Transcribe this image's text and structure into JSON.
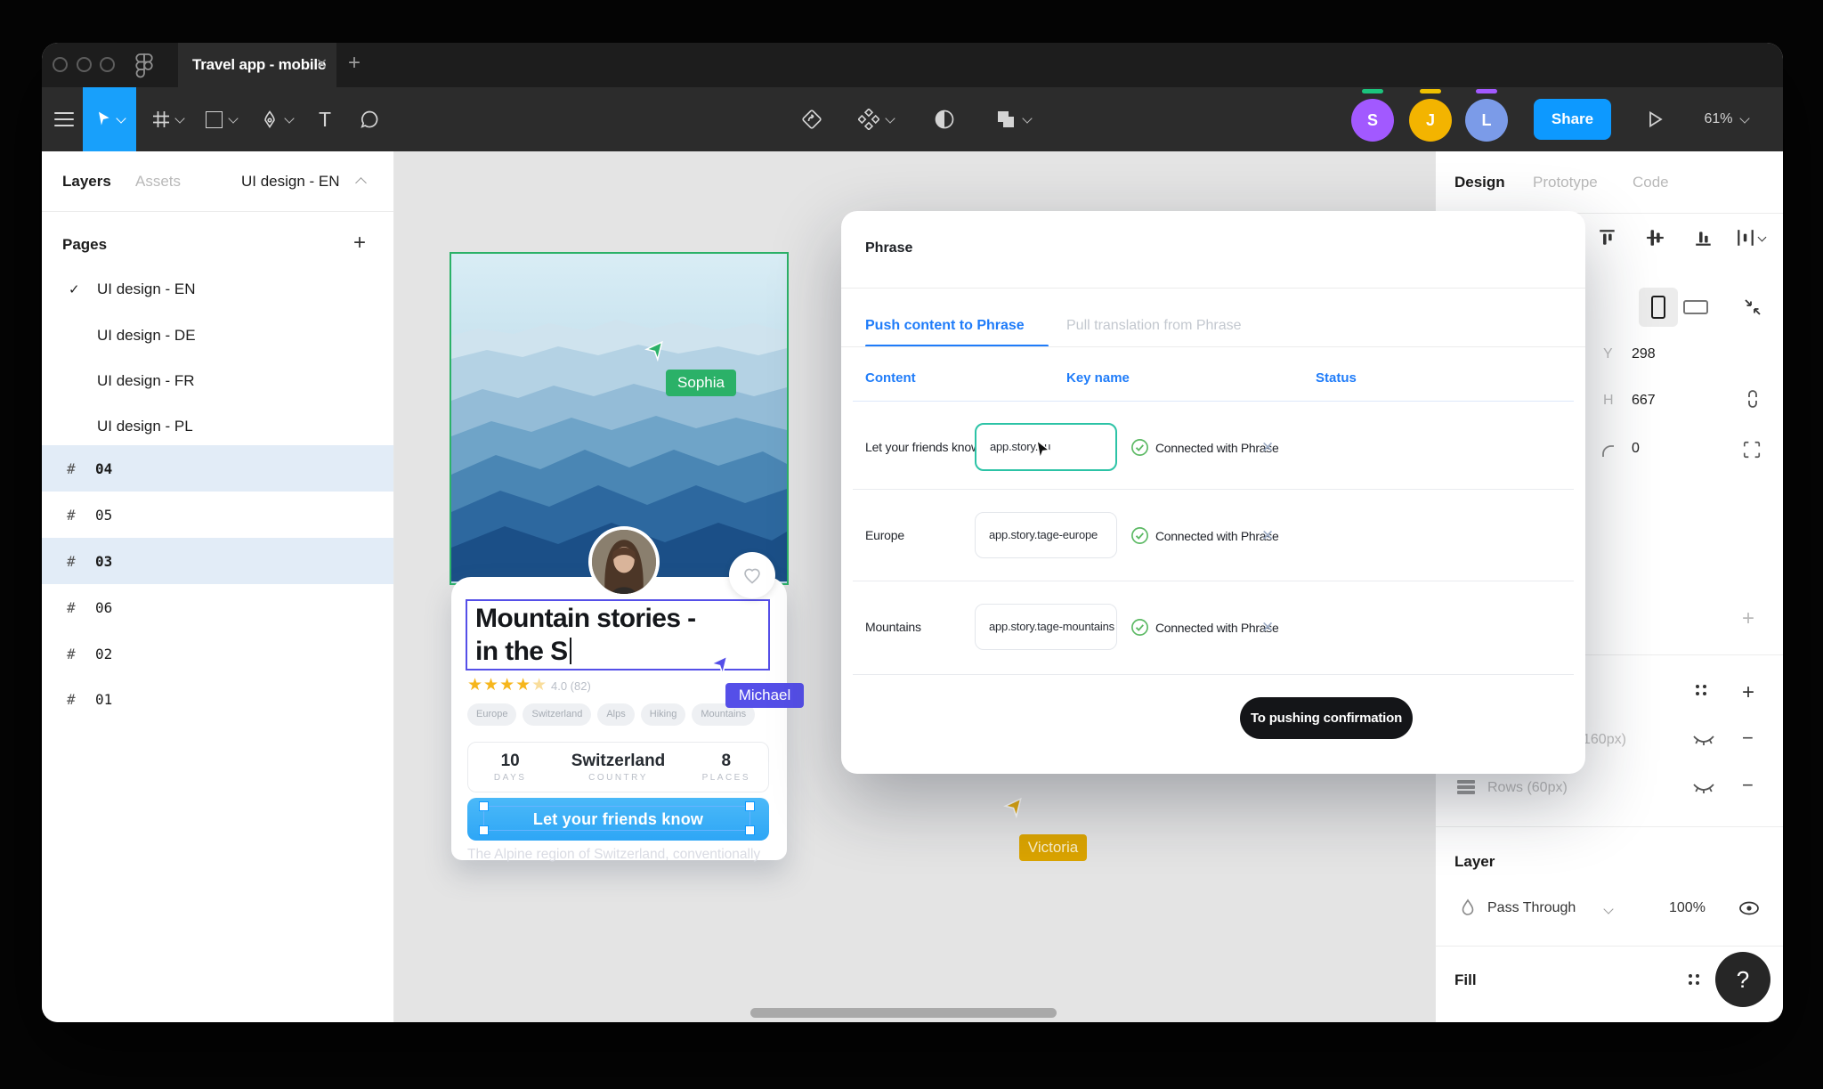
{
  "topbar": {
    "tab_title": "Travel app - mobile",
    "close_tab": "✕",
    "new_tab": "+",
    "share_label": "Share",
    "zoom_level": "61%",
    "collaborators": [
      {
        "initial": "S",
        "color": "#a259ff",
        "indicator": "#1bc47d"
      },
      {
        "initial": "J",
        "color": "#f3b400",
        "indicator": "#efc000"
      },
      {
        "initial": "L",
        "color": "#7b9be8",
        "indicator": "#a259ff"
      }
    ]
  },
  "left_sidebar": {
    "layers_tab": "Layers",
    "assets_tab": "Assets",
    "page_selector": "UI design - EN",
    "pages_header": "Pages",
    "add_page": "+",
    "check": "✓",
    "hash": "#",
    "pages": [
      {
        "label": "UI design - EN"
      },
      {
        "label": "UI design - DE"
      },
      {
        "label": "UI design - FR"
      },
      {
        "label": "UI design - PL"
      }
    ],
    "frames": [
      {
        "label": "04"
      },
      {
        "label": "05"
      },
      {
        "label": "03"
      },
      {
        "label": "06"
      },
      {
        "label": "02"
      },
      {
        "label": "01"
      }
    ]
  },
  "canvas": {
    "story_card": {
      "title_line1": "Mountain stories -",
      "title_line2": "in the S",
      "stars_full": "★★★★",
      "star_faded": "★",
      "rating_value": "4.0 (82)",
      "tags": [
        "Europe",
        "Switzerland",
        "Alps",
        "Hiking",
        "Mountains"
      ],
      "stats": [
        {
          "value": "10",
          "label": "DAYS"
        },
        {
          "value": "Switzerland",
          "label": "COUNTRY"
        },
        {
          "value": "8",
          "label": "PLACES"
        }
      ],
      "cta_label": "Let your friends know",
      "description": "The Alpine region of Switzerland, conventionally"
    },
    "cursors": [
      {
        "name": "Sophia",
        "color": "#2bb168"
      },
      {
        "name": "Michael",
        "color": "#554fe8"
      },
      {
        "name": "Victoria",
        "color": "#dba400"
      }
    ]
  },
  "modal": {
    "title": "Phrase",
    "tab_push": "Push content to Phrase",
    "tab_pull": "Pull translation from Phrase",
    "col_content": "Content",
    "col_key": "Key name",
    "col_status": "Status",
    "close": "✕",
    "rows": [
      {
        "content": "Let your friends know",
        "key": "app.story.bu",
        "status": "Connected with Phrase"
      },
      {
        "content": "Europe",
        "key": "app.story.tage-europe",
        "status": "Connected with Phrase"
      },
      {
        "content": "Mountains",
        "key": "app.story.tage-mountains",
        "status": "Connected with Phrase"
      }
    ],
    "confirm_label": "To pushing confirmation"
  },
  "right_panel": {
    "tab_design": "Design",
    "tab_prototype": "Prototype",
    "tab_code": "Code",
    "y_label": "Y",
    "y_value": "298",
    "h_label": "H",
    "h_value": "667",
    "radius_value": "0",
    "add": "+",
    "minus": "−",
    "grid_fragment": "160px)",
    "rows_label": "Rows (60px)",
    "layer_header": "Layer",
    "blend_mode": "Pass Through",
    "opacity": "100%",
    "fill_header": "Fill",
    "help_label": "?"
  }
}
